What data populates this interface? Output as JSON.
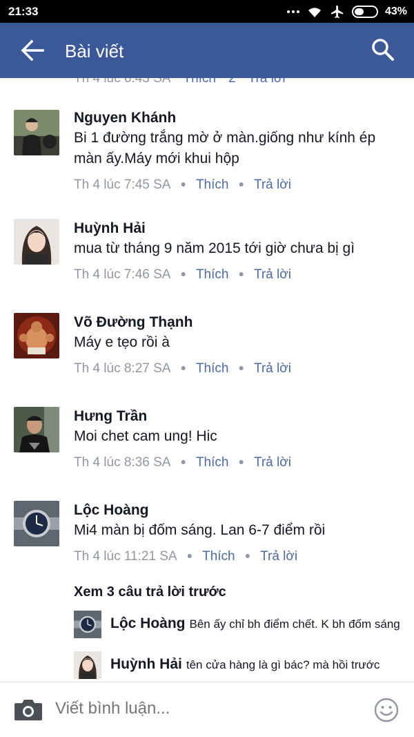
{
  "status": {
    "time": "21:33",
    "battery": "43%",
    "battery_level": 0.43
  },
  "header": {
    "title": "Bài viết"
  },
  "previous_row": {
    "time": "Th 4 lúc 6:43 SA",
    "like": "Thích",
    "count": "2",
    "reply": "Trả lời"
  },
  "comments": [
    {
      "name": "Nguyen Khánh",
      "text": "Bi 1 đường trắng mờ ở màn.giống như kính ép màn ấy.Máy mới khui hộp",
      "time": "Th 4 lúc 7:45 SA",
      "like": "Thích",
      "reply": "Trả lời"
    },
    {
      "name": "Huỳnh Hải",
      "text": "mua từ tháng 9 năm 2015 tới giờ chưa bị gì",
      "time": "Th 4 lúc 7:46 SA",
      "like": "Thích",
      "reply": "Trả lời"
    },
    {
      "name": "Võ Đường Thạnh",
      "text": "Máy e tẹo rồi à",
      "time": "Th 4 lúc 8:27 SA",
      "like": "Thích",
      "reply": "Trả lời"
    },
    {
      "name": "Hưng Trần",
      "text": "Moi chet cam ung! Hic",
      "time": "Th 4 lúc 8:36 SA",
      "like": "Thích",
      "reply": "Trả lời"
    },
    {
      "name": "Lộc Hoàng",
      "text": "Mi4 màn bị đốm sáng. Lan 6-7 điểm rồi",
      "time": "Th 4 lúc 11:21 SA",
      "like": "Thích",
      "reply": "Trả lời"
    }
  ],
  "replies": {
    "view_previous": "Xem 3 câu trả lời trước",
    "items": [
      {
        "name": "Lộc Hoàng",
        "text": "Bên ấy chỉ bh điểm chết. K bh đốm sáng"
      },
      {
        "name": "Huỳnh Hải",
        "text": "tên cửa hàng là gì bác? mà hồi trước"
      }
    ]
  },
  "composer": {
    "placeholder": "Viết bình luận..."
  }
}
